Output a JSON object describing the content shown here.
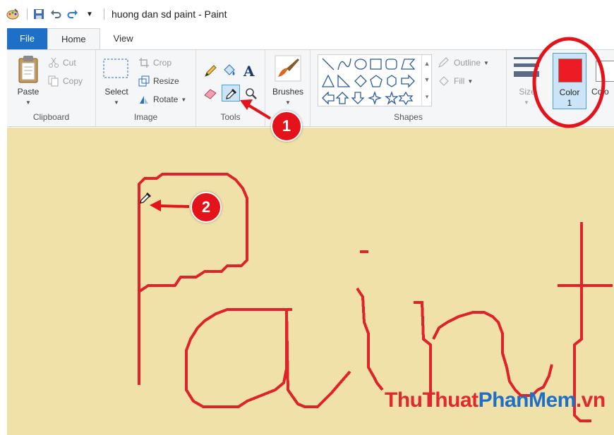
{
  "window": {
    "title": "huong dan sd paint - Paint"
  },
  "menu": {
    "tabs": [
      "File",
      "Home",
      "View"
    ]
  },
  "ribbon": {
    "clipboard": {
      "label": "Clipboard",
      "paste": "Paste",
      "cut": "Cut",
      "copy": "Copy"
    },
    "image": {
      "label": "Image",
      "select": "Select",
      "crop": "Crop",
      "resize": "Resize",
      "rotate": "Rotate"
    },
    "tools": {
      "label": "Tools"
    },
    "brushes": {
      "label": "Brushes"
    },
    "shapes": {
      "label": "Shapes",
      "outline": "Outline",
      "fill": "Fill"
    },
    "size": {
      "label": "Size"
    },
    "color1": {
      "label": "Color",
      "number": "1",
      "value": "#ed1c24"
    },
    "color2": {
      "label": "Colo"
    }
  },
  "canvas": {
    "background": "#f0e1a9",
    "stroke_color": "#e0232b"
  },
  "annotations": {
    "callout1": "1",
    "callout2": "2",
    "highlight_color": "#e4131b"
  },
  "watermark": {
    "part1": "ThuThuat",
    "part2": "PhanMem",
    "part3": ".vn"
  },
  "icons": {
    "paint-app": "paint-palette-icon",
    "save": "save-icon",
    "undo": "undo-icon",
    "redo": "redo-icon",
    "color-picker": "eyedropper-icon"
  }
}
